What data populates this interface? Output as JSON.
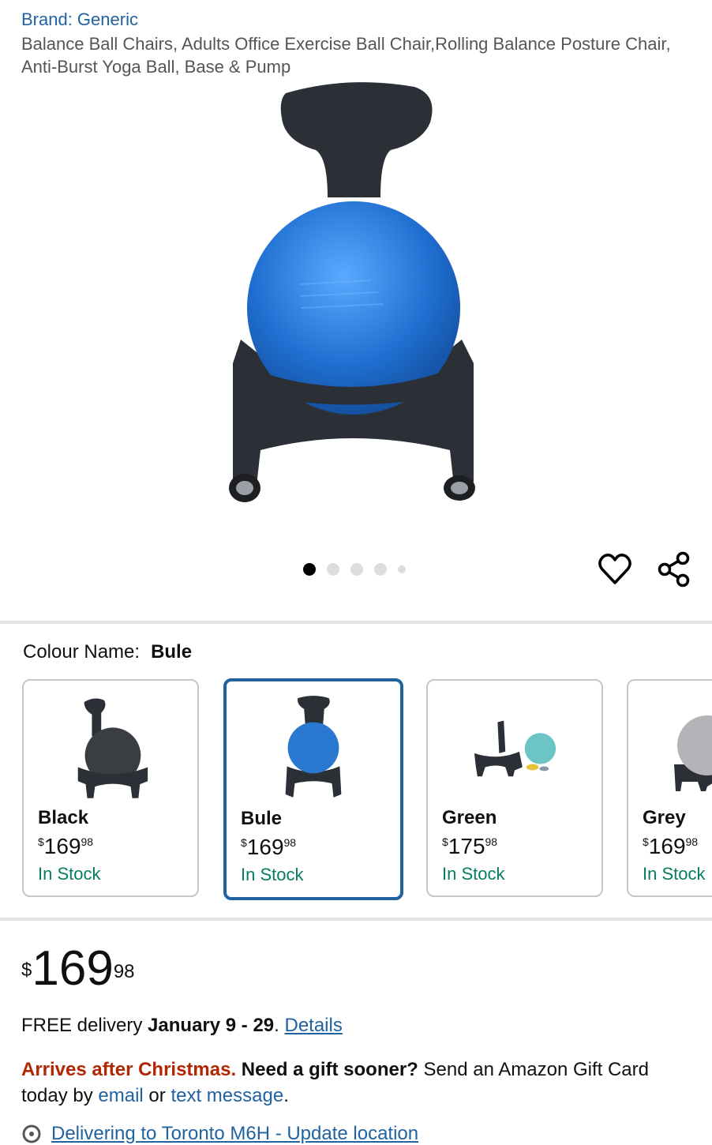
{
  "product": {
    "brand": "Brand: Generic",
    "title": "Balance Ball Chairs, Adults Office Exercise Ball Chair,Rolling Balance Posture Chair, Anti-Burst Yoga Ball, Base & Pump"
  },
  "carousel": {
    "total": 5,
    "active": 0
  },
  "icons": {
    "wishlist": "heart-icon",
    "share": "share-icon",
    "location": "location-pin-icon"
  },
  "colour": {
    "label": "Colour Name:",
    "value": "Bule",
    "options": [
      {
        "name": "Black",
        "currency": "$",
        "whole": "169",
        "fraction": "98",
        "stock": "In Stock",
        "ball_color": "#3a3d42"
      },
      {
        "name": "Bule",
        "currency": "$",
        "whole": "169",
        "fraction": "98",
        "stock": "In Stock",
        "ball_color": "#2a78d0"
      },
      {
        "name": "Green",
        "currency": "$",
        "whole": "175",
        "fraction": "98",
        "stock": "In Stock",
        "ball_color": "#6cc4c4"
      },
      {
        "name": "Grey",
        "currency": "$",
        "whole": "169",
        "fraction": "98",
        "stock": "In Stock",
        "ball_color": "#b4b4b8"
      }
    ]
  },
  "price": {
    "currency": "$",
    "whole": "169",
    "fraction": "98"
  },
  "delivery": {
    "prefix": "FREE delivery ",
    "dates": "January 9 - 29",
    "sep": ". ",
    "details_link": "Details"
  },
  "gift": {
    "arrives": "Arrives after Christmas.",
    "need": " Need a gift sooner?",
    "send": " Send an Amazon Gift Card today by ",
    "email_link": "email",
    "or": " or ",
    "text_link": "text message",
    "end": "."
  },
  "location": {
    "text": "Delivering to Toronto M6H - Update location"
  },
  "colors": {
    "link": "#2162a1",
    "stock": "#067d62",
    "alert": "#b12704",
    "selected_border": "#2162a1"
  }
}
